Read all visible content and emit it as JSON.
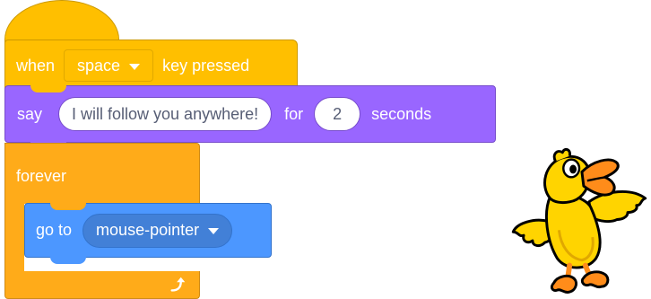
{
  "event_block": {
    "when_label": "when",
    "key_value": "space",
    "key_pressed_label": "key pressed"
  },
  "say_block": {
    "say_label": "say",
    "message_value": "I will follow you anywhere!",
    "for_label": "for",
    "seconds_value": "2",
    "seconds_label": "seconds"
  },
  "forever_block": {
    "label": "forever",
    "loop_icon": "loop-arrow-icon"
  },
  "goto_block": {
    "go_to_label": "go to",
    "target_value": "mouse-pointer"
  },
  "sprite": {
    "icon": "duck-sprite"
  },
  "colors": {
    "events": "#ffbf00",
    "looks": "#9966ff",
    "control": "#ffab19",
    "motion": "#4c97ff",
    "input_text": "#575e75"
  }
}
